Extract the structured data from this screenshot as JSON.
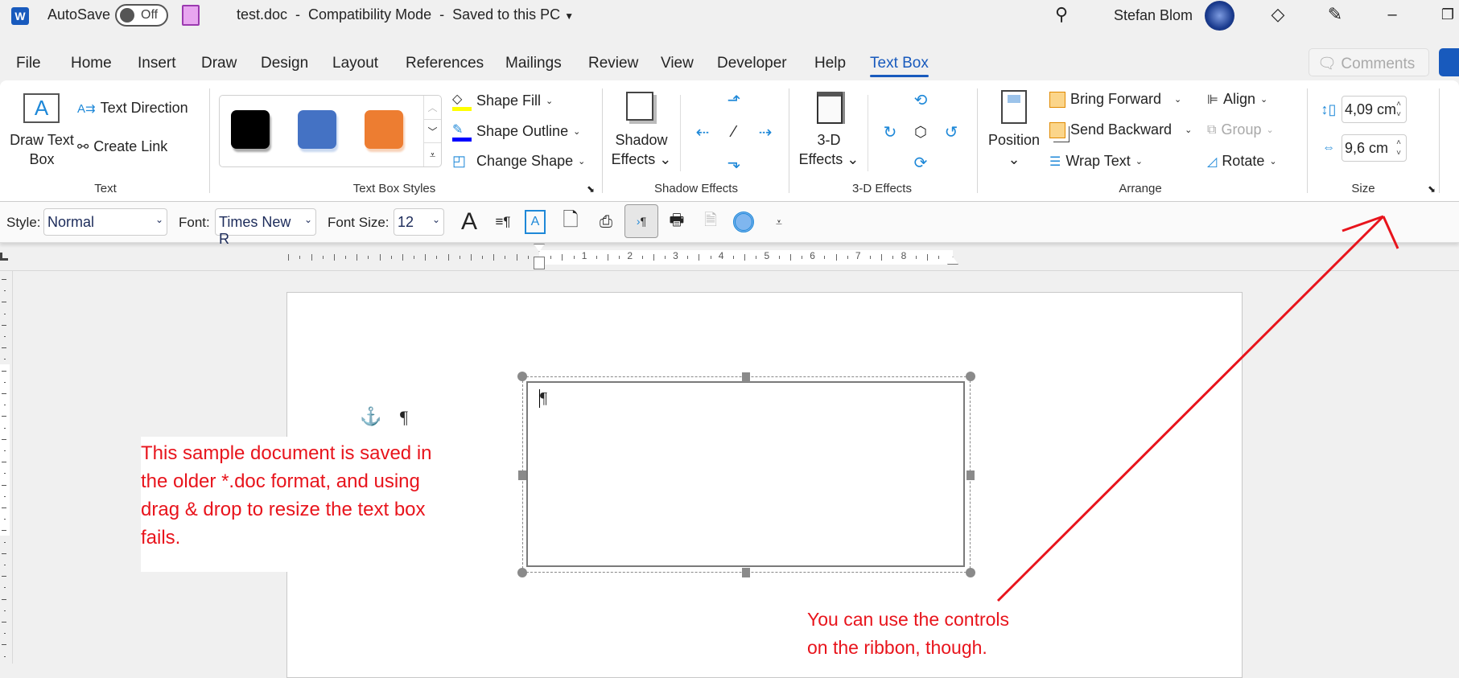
{
  "titlebar": {
    "autosave_label": "AutoSave",
    "autosave_state": "Off",
    "document_title": "test.doc  -  Compatibility Mode  -  Saved to this PC",
    "user_name": "Stefan Blom"
  },
  "tabs": [
    "File",
    "Home",
    "Insert",
    "Draw",
    "Design",
    "Layout",
    "References",
    "Mailings",
    "Review",
    "View",
    "Developer",
    "Help",
    "Text Box"
  ],
  "active_tab": "Text Box",
  "comments_label": "Comments",
  "ribbon": {
    "text_group": {
      "label": "Text",
      "draw_text_box": "Draw Text Box",
      "text_direction": "Text Direction",
      "create_link": "Create Link"
    },
    "styles_group": {
      "label": "Text Box Styles",
      "swatches": [
        "#000000",
        "#4472c4",
        "#ed7d31"
      ],
      "shape_fill": "Shape Fill",
      "shape_outline": "Shape Outline",
      "change_shape": "Change Shape"
    },
    "shadow_group": {
      "label": "Shadow Effects",
      "shadow_effects": "Shadow Effects"
    },
    "threed_group": {
      "label": "3-D Effects",
      "effects_line1": "3-D",
      "effects_line2": "Effects"
    },
    "arrange_group": {
      "label": "Arrange",
      "position": "Position",
      "bring_forward": "Bring Forward",
      "send_backward": "Send Backward",
      "wrap_text": "Wrap Text",
      "align": "Align",
      "group": "Group",
      "rotate": "Rotate"
    },
    "size_group": {
      "label": "Size",
      "height": "4,09 cm",
      "width": "9,6 cm"
    }
  },
  "format_toolbar": {
    "style_label": "Style:",
    "style_value": "Normal",
    "font_label": "Font:",
    "font_value": "Times New R",
    "size_label": "Font Size:",
    "size_value": "12"
  },
  "ruler_numbers": [
    "1",
    "2",
    "3",
    "4",
    "5",
    "6",
    "7",
    "8"
  ],
  "document": {
    "pilcrow": "¶",
    "note_left": [
      "This sample document is saved in",
      "the older *.doc format, and using",
      "drag & drop to resize the text box",
      "fails."
    ],
    "note_right": [
      "You can use the controls",
      "on the ribbon, though."
    ]
  },
  "colors": {
    "accent": "#185abd",
    "annotation": "#e8141c",
    "icon_blue": "#1e88d8"
  }
}
